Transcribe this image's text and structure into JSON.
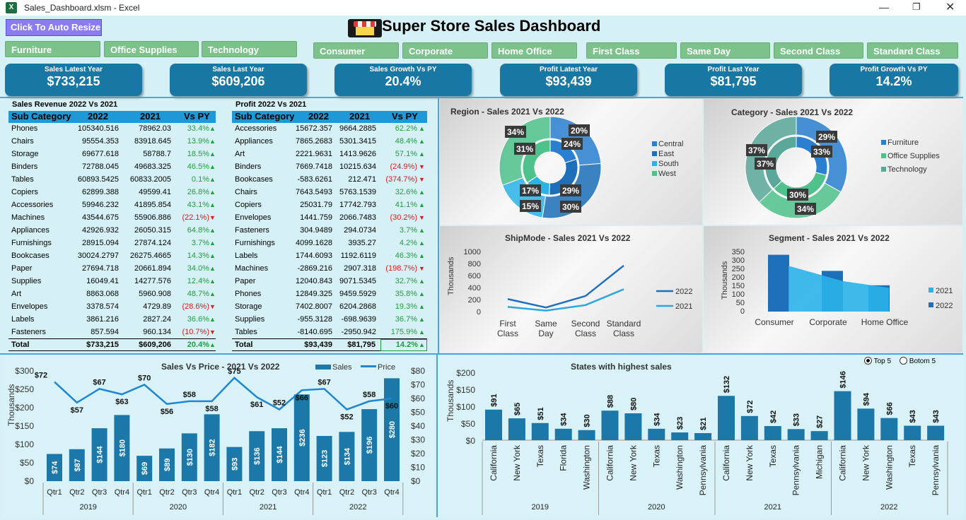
{
  "titlebar": {
    "title": "Sales_Dashboard.xlsm - Excel",
    "app_icon": "X"
  },
  "toolbar": {
    "resize_label": "Click To Auto Resize"
  },
  "dashboard": {
    "title": "Super Store Sales Dashboard"
  },
  "slicers": {
    "category": [
      "Furniture",
      "Office Supplies",
      "Technology"
    ],
    "segment": [
      "Consumer",
      "Corporate",
      "Home Office"
    ],
    "shipmode": [
      "First Class",
      "Same Day",
      "Second Class",
      "Standard Class"
    ]
  },
  "kpis": [
    {
      "label": "Sales Latest Year",
      "value": "$733,215"
    },
    {
      "label": "Sales Last Year",
      "value": "$609,206"
    },
    {
      "label": "Sales  Growth Vs PY",
      "value": "20.4%"
    },
    {
      "label": "Profit Latest Year",
      "value": "$93,439"
    },
    {
      "label": "Profit Last Year",
      "value": "$81,795"
    },
    {
      "label": "Profit Growth Vs PY",
      "value": "14.2%"
    }
  ],
  "sales_table": {
    "caption": "Sales Revenue 2022 Vs 2021",
    "headers": [
      "Sub Category",
      "2022",
      "2021",
      "Vs PY"
    ],
    "rows": [
      [
        "Phones",
        "105340.516",
        "78962.03",
        "33.4%",
        "up"
      ],
      [
        "Chairs",
        "95554.353",
        "83918.645",
        "13.9%",
        "up"
      ],
      [
        "Storage",
        "69677.618",
        "58788.7",
        "18.5%",
        "up"
      ],
      [
        "Binders",
        "72788.045",
        "49683.325",
        "46.5%",
        "up"
      ],
      [
        "Tables",
        "60893.5425",
        "60833.2005",
        "0.1%",
        "up"
      ],
      [
        "Copiers",
        "62899.388",
        "49599.41",
        "26.8%",
        "up"
      ],
      [
        "Accessories",
        "59946.232",
        "41895.854",
        "43.1%",
        "up"
      ],
      [
        "Machines",
        "43544.675",
        "55906.886",
        "(22.1%)",
        "down"
      ],
      [
        "Appliances",
        "42926.932",
        "26050.315",
        "64.8%",
        "up"
      ],
      [
        "Furnishings",
        "28915.094",
        "27874.124",
        "3.7%",
        "up"
      ],
      [
        "Bookcases",
        "30024.2797",
        "26275.4665",
        "14.3%",
        "up"
      ],
      [
        "Paper",
        "27694.718",
        "20661.894",
        "34.0%",
        "up"
      ],
      [
        "Supplies",
        "16049.41",
        "14277.576",
        "12.4%",
        "up"
      ],
      [
        "Art",
        "8863.068",
        "5960.908",
        "48.7%",
        "up"
      ],
      [
        "Envelopes",
        "3378.574",
        "4729.89",
        "(28.6%)",
        "down"
      ],
      [
        "Labels",
        "3861.216",
        "2827.24",
        "36.6%",
        "up"
      ],
      [
        "Fasteners",
        "857.594",
        "960.134",
        "(10.7%)",
        "down"
      ]
    ],
    "total": [
      "Total",
      "$733,215",
      "$609,206",
      "20.4%"
    ]
  },
  "profit_table": {
    "caption": "Profit 2022 Vs 2021",
    "headers": [
      "Sub Category",
      "2022",
      "2021",
      "Vs PY"
    ],
    "rows": [
      [
        "Accessories",
        "15672.357",
        "9664.2885",
        "62.2%",
        "up"
      ],
      [
        "Appliances",
        "7865.2683",
        "5301.3415",
        "48.4%",
        "up"
      ],
      [
        "Art",
        "2221.9631",
        "1413.9626",
        "57.1%",
        "up"
      ],
      [
        "Binders",
        "7669.7418",
        "10215.634",
        "(24.9%)",
        "down"
      ],
      [
        "Bookcases",
        "-583.6261",
        "212.471",
        "(374.7%)",
        "down"
      ],
      [
        "Chairs",
        "7643.5493",
        "5763.1539",
        "32.6%",
        "up"
      ],
      [
        "Copiers",
        "25031.79",
        "17742.793",
        "41.1%",
        "up"
      ],
      [
        "Envelopes",
        "1441.759",
        "2066.7483",
        "(30.2%)",
        "down"
      ],
      [
        "Fasteners",
        "304.9489",
        "294.0734",
        "3.7%",
        "up"
      ],
      [
        "Furnishings",
        "4099.1628",
        "3935.27",
        "4.2%",
        "up"
      ],
      [
        "Labels",
        "1744.6093",
        "1192.6119",
        "46.3%",
        "up"
      ],
      [
        "Machines",
        "-2869.216",
        "2907.318",
        "(198.7%)",
        "down"
      ],
      [
        "Paper",
        "12040.843",
        "9071.5345",
        "32.7%",
        "up"
      ],
      [
        "Phones",
        "12849.325",
        "9459.5929",
        "35.8%",
        "up"
      ],
      [
        "Storage",
        "7402.8007",
        "6204.2868",
        "19.3%",
        "up"
      ],
      [
        "Supplies",
        "-955.3128",
        "-698.9639",
        "36.7%",
        "up"
      ],
      [
        "Tables",
        "-8140.695",
        "-2950.942",
        "175.9%",
        "up"
      ]
    ],
    "total": [
      "Total",
      "$93,439",
      "$81,795",
      "14.2%"
    ]
  },
  "arrows": {
    "up": "▲",
    "down": "▼"
  },
  "radio": {
    "top5": "Top 5",
    "bottom5": "Botom 5"
  },
  "colors": {
    "accent": "#1878a3",
    "slicer": "#7dc28b",
    "positive": "#1e9e3a",
    "negative": "#e01818"
  },
  "chart_data": [
    {
      "type": "pie",
      "title": "Region - Sales 2021 Vs 2022",
      "legend": [
        "Central",
        "East",
        "South",
        "West"
      ],
      "series": [
        {
          "name": "2022",
          "values": [
            20,
            30,
            15,
            34
          ]
        },
        {
          "name": "2021",
          "values": [
            24,
            29,
            17,
            31
          ]
        }
      ],
      "colors": [
        "#2a7fd0",
        "#1c6fb8",
        "#2bb3e8",
        "#4fc18a"
      ]
    },
    {
      "type": "pie",
      "title": "Category - Sales 2021 Vs 2022",
      "legend": [
        "Furniture",
        "Office Supplies",
        "Technology"
      ],
      "series": [
        {
          "name": "2022",
          "values": [
            29,
            34,
            37
          ]
        },
        {
          "name": "2021",
          "values": [
            33,
            30,
            37
          ]
        }
      ],
      "colors": [
        "#2a7fd0",
        "#4fc18a",
        "#5aa89a"
      ]
    },
    {
      "type": "line",
      "title": "ShipMode - Sales 2021 Vs 2022",
      "ylabel": "Thousands",
      "categories": [
        "First Class",
        "Same Day",
        "Second Class",
        "Standard Class"
      ],
      "series": [
        {
          "name": "2022",
          "values": [
            230,
            90,
            280,
            780
          ]
        },
        {
          "name": "2021",
          "values": [
            100,
            40,
            130,
            390
          ]
        }
      ],
      "yticks": [
        "1000",
        "800",
        "600",
        "400",
        "200",
        "0"
      ],
      "ylim": [
        0,
        1000
      ]
    },
    {
      "type": "area",
      "title": "Segment - Sales 2021 Vs 2022",
      "ylabel": "Thousands",
      "categories": [
        "Consumer",
        "Corporate",
        "Home Office"
      ],
      "series": [
        {
          "name": "2021",
          "values": [
            270,
            180,
            140
          ]
        },
        {
          "name": "2022",
          "values": [
            335,
            240,
            155
          ]
        }
      ],
      "yticks": [
        "350",
        "300",
        "250",
        "200",
        "150",
        "100",
        "50",
        "0"
      ],
      "ylim": [
        0,
        350
      ]
    },
    {
      "type": "bar",
      "title": "Sales Vs Price - 2021 Vs 2022",
      "ylabel": "Thousands",
      "categories": [
        "Qtr1",
        "Qtr2",
        "Qtr3",
        "Qtr4",
        "Qtr1",
        "Qtr2",
        "Qtr3",
        "Qtr4",
        "Qtr1",
        "Qtr2",
        "Qtr3",
        "Qtr4",
        "Qtr1",
        "Qtr2",
        "Qtr3",
        "Qtr4"
      ],
      "groups": [
        "2019",
        "2020",
        "2021",
        "2022"
      ],
      "series": [
        {
          "name": "Sales",
          "values": [
            74,
            87,
            144,
            180,
            69,
            89,
            130,
            182,
            93,
            136,
            144,
            236,
            123,
            134,
            196,
            280
          ]
        },
        {
          "name": "Price",
          "values": [
            72,
            57,
            67,
            63,
            70,
            56,
            58,
            58,
            75,
            61,
            52,
            66,
            67,
            52,
            58,
            60
          ]
        }
      ],
      "yticks_left": [
        "$300",
        "$250",
        "$200",
        "$150",
        "$100",
        "$50",
        "$0"
      ],
      "yticks_right": [
        "$80",
        "$70",
        "$60",
        "$50",
        "$40",
        "$30",
        "$20",
        "$10",
        "$0"
      ],
      "ylim": [
        0,
        300
      ],
      "y2lim": [
        0,
        80
      ]
    },
    {
      "type": "bar",
      "title": "States with highest sales",
      "ylabel": "Thousands",
      "categories": [
        "California",
        "New York",
        "Texas",
        "Florida",
        "Washington",
        "California",
        "New York",
        "Texas",
        "Washington",
        "Pennsylvania",
        "California",
        "New York",
        "Texas",
        "Pennsylvania",
        "Michigan",
        "California",
        "New York",
        "Washington",
        "Texas",
        "Pennsylvania"
      ],
      "groups": [
        "2019",
        "2020",
        "2021",
        "2022"
      ],
      "values": [
        91,
        65,
        51,
        34,
        30,
        88,
        80,
        34,
        23,
        21,
        132,
        72,
        42,
        33,
        27,
        146,
        94,
        66,
        43,
        43
      ],
      "yticks": [
        "$200",
        "$150",
        "$100",
        "$50",
        "$0"
      ],
      "ylim": [
        0,
        200
      ]
    }
  ]
}
